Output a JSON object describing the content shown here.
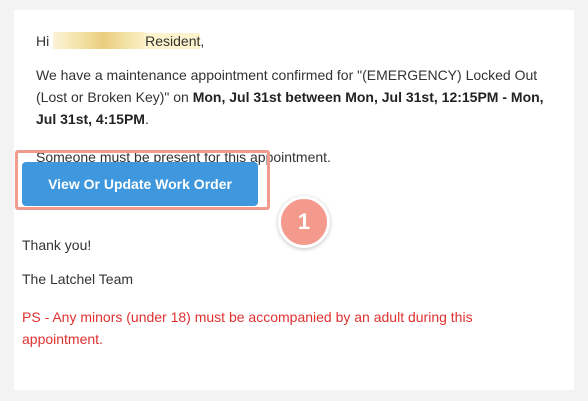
{
  "email": {
    "greeting_prefix": "Hi",
    "greeting_name": "Resident",
    "greeting_suffix": ",",
    "appointment_text_1": "We have a maintenance appointment confirmed for \"(EMERGENCY) Locked Out (Lost or Broken Key)\" on ",
    "appointment_time": "Mon, Jul 31st between Mon, Jul 31st, 12:15PM - Mon, Jul 31st, 4:15PM",
    "appointment_text_2": ".",
    "presence_note": "Someone must be present for this appointment.",
    "button_label": "View Or Update Work Order",
    "thanks": "Thank you!",
    "signature": "The Latchel Team",
    "ps_note": "PS - Any minors (under 18) must be accompanied by an adult during this appointment."
  },
  "annotation": {
    "step_number": "1",
    "highlight_color": "#f19a8e",
    "badge_color": "#f49a8c"
  },
  "colors": {
    "button": "#3f97dd",
    "ps_text": "#e03131",
    "text": "#333333"
  }
}
